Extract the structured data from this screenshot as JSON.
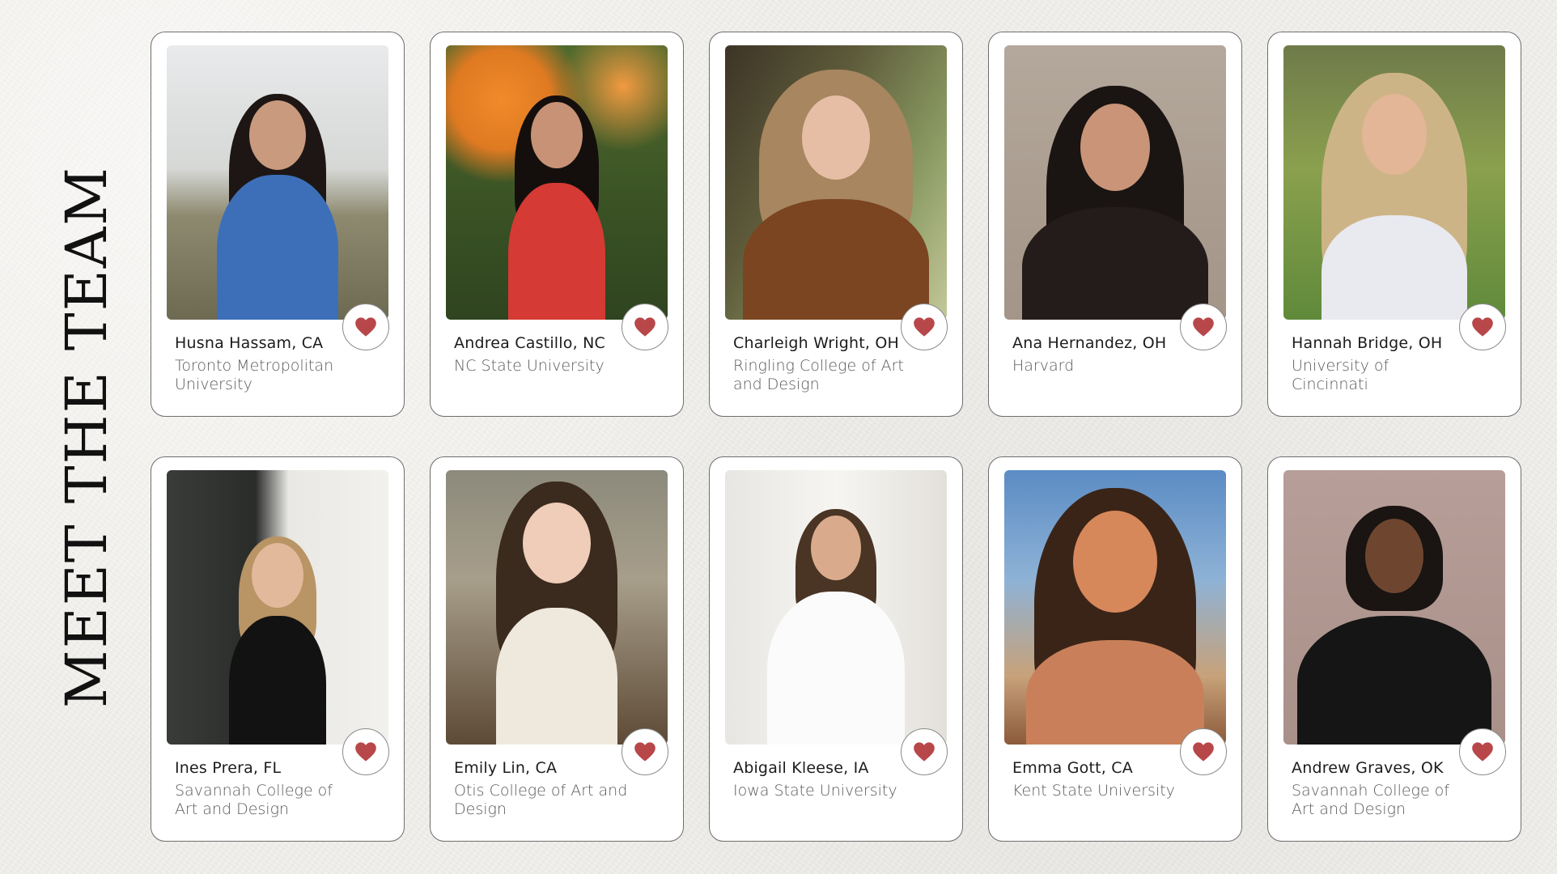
{
  "page": {
    "title": "MEET THE TEAM"
  },
  "colors": {
    "heart": "#b8474a",
    "card_border": "#6e6e6e",
    "background": "#f2f0ec"
  },
  "icons": {
    "favorite": "heart-icon"
  },
  "team": [
    {
      "name": "Husna Hassam, CA",
      "school": "Toronto Metropolitan University"
    },
    {
      "name": "Andrea Castillo, NC",
      "school": "NC State University"
    },
    {
      "name": "Charleigh Wright, OH",
      "school": "Ringling College of Art and Design"
    },
    {
      "name": "Ana Hernandez, OH",
      "school": "Harvard"
    },
    {
      "name": "Hannah Bridge, OH",
      "school": "University of Cincinnati"
    },
    {
      "name": "Ines Prera, FL",
      "school": "Savannah College of Art and Design"
    },
    {
      "name": "Emily Lin, CA",
      "school": "Otis College of Art and Design"
    },
    {
      "name": "Abigail Kleese, IA",
      "school": "Iowa State University"
    },
    {
      "name": "Emma Gott,  CA",
      "school": "Kent State University"
    },
    {
      "name": "Andrew Graves, OK",
      "school": "Savannah College of Art and Design"
    }
  ]
}
